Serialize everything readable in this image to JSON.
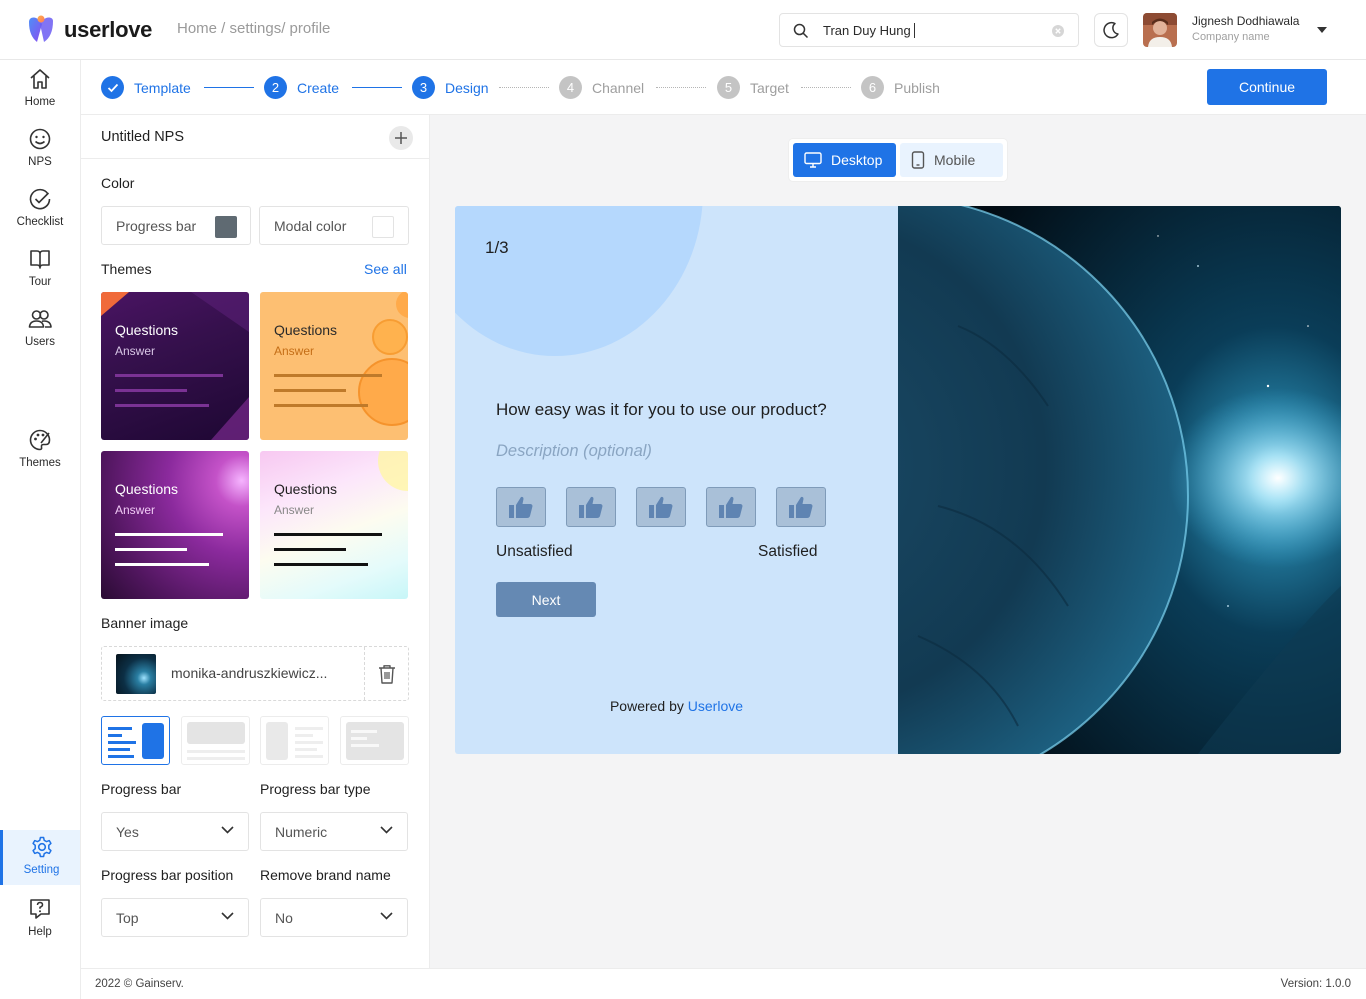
{
  "brand": {
    "name": "userlove",
    "accent": "#1f73e6"
  },
  "breadcrumb": "Home / settings/ profile",
  "search": {
    "value": "Tran Duy Hung"
  },
  "user": {
    "name": "Jignesh Dodhiawala",
    "company": "Company name"
  },
  "nav": {
    "home": "Home",
    "nps": "NPS",
    "checklist": "Checklist",
    "tour": "Tour",
    "users": "Users",
    "themes": "Themes",
    "setting": "Setting",
    "help": "Help"
  },
  "steps": [
    {
      "num": "1",
      "label": "Template",
      "state": "done"
    },
    {
      "num": "2",
      "label": "Create",
      "state": "done"
    },
    {
      "num": "3",
      "label": "Design",
      "state": "current"
    },
    {
      "num": "4",
      "label": "Channel",
      "state": "todo"
    },
    {
      "num": "5",
      "label": "Target",
      "state": "todo"
    },
    {
      "num": "6",
      "label": "Publish",
      "state": "todo"
    }
  ],
  "continue_label": "Continue",
  "panel": {
    "survey_name": "Untitled NPS",
    "color_label": "Color",
    "progress_bar_color_label": "Progress bar",
    "progress_bar_color": "#5f6a72",
    "modal_color_label": "Modal color",
    "modal_color": "#ffffff",
    "themes_label": "Themes",
    "see_all": "See all",
    "themes": [
      {
        "q": "Questions",
        "a": "Answer"
      },
      {
        "q": "Questions",
        "a": "Answer"
      },
      {
        "q": "Questions",
        "a": "Answer"
      },
      {
        "q": "Questions",
        "a": "Answer"
      }
    ],
    "banner_label": "Banner image",
    "banner_file": "monika-andruszkiewicz...",
    "progress_bar_label": "Progress bar",
    "progress_bar_value": "Yes",
    "progress_bar_type_label": "Progress bar type",
    "progress_bar_type_value": "Numeric",
    "progress_bar_position_label": "Progress bar position",
    "progress_bar_position_value": "Top",
    "remove_brand_label": "Remove brand name",
    "remove_brand_value": "No"
  },
  "device": {
    "desktop": "Desktop",
    "mobile": "Mobile",
    "selected": "Desktop"
  },
  "preview": {
    "counter": "1/3",
    "question": "How easy was it for you to use our product?",
    "description": "Description (optional)",
    "low_label": "Unsatisfied",
    "high_label": "Satisfied",
    "next_label": "Next",
    "powered_prefix": "Powered by",
    "powered_brand": "Userlove"
  },
  "footer": {
    "copyright": "2022 © Gainserv.",
    "version": "Version: 1.0.0"
  }
}
